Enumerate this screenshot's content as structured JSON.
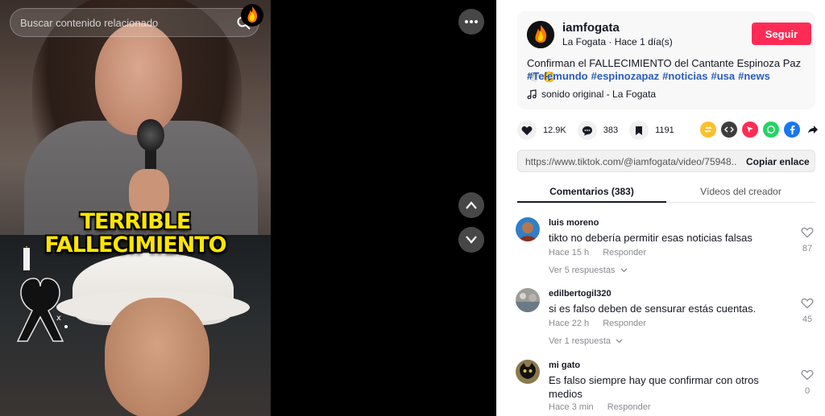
{
  "search": {
    "placeholder": "Buscar contenido relacionado"
  },
  "video": {
    "overlay_line1": "TERRIBLE",
    "overlay_line2": "FALLECIMIENTO"
  },
  "creator": {
    "handle": "iamfogata",
    "name": "La Fogata",
    "separator": " · ",
    "time": "Hace 1 día(s)",
    "follow_label": "Seguir",
    "description": "Confirman el FALLECIMIENTO del Cantante Espinoza Paz 🕊️ 😳",
    "hashtags": [
      "#Telemundo",
      "#espinozapaz",
      "#noticias",
      "#usa",
      "#news"
    ],
    "sound": "sonido original - La Fogata"
  },
  "stats": {
    "likes": "12.9K",
    "comments": "383",
    "saves": "1191"
  },
  "share_icons": [
    "repost-icon",
    "embed-icon",
    "send-icon",
    "whatsapp-icon",
    "facebook-icon",
    "share-arrow-icon"
  ],
  "link": {
    "url": "https://www.tiktok.com/@iamfogata/video/75948...",
    "copy_label": "Copiar enlace"
  },
  "tabs": {
    "comments": "Comentarios (383)",
    "creator_videos": "Vídeos del creador"
  },
  "comments": [
    {
      "user": "luis moreno",
      "text": "tikto no debería permitir esas noticias falsas",
      "time": "Hace 15 h",
      "reply": "Responder",
      "replies": "Ver 5 respuestas",
      "likes": "87"
    },
    {
      "user": "edilbertogil320",
      "text": "si es falso deben de sensurar estás cuentas.",
      "time": "Hace 22 h",
      "reply": "Responder",
      "replies": "Ver 1 respuesta",
      "likes": "45"
    },
    {
      "user": "mi gato",
      "text": "Es falso siempre hay que confirmar con otros medios",
      "time": "Hace 3 min",
      "reply": "Responder",
      "replies": "",
      "likes": "0"
    }
  ],
  "colors": {
    "accent": "#fe2c55",
    "hashtag": "#2b5db9",
    "overlay_text": "#ffe600"
  }
}
